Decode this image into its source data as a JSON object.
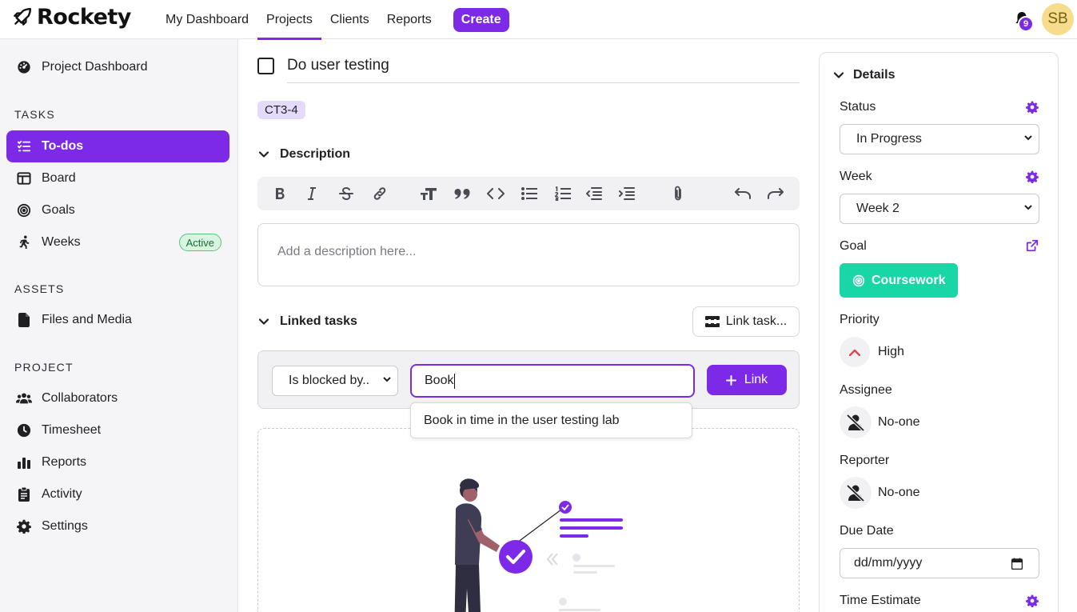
{
  "app": {
    "name": "Rockety"
  },
  "nav": {
    "items": [
      {
        "label": "My Dashboard"
      },
      {
        "label": "Projects"
      },
      {
        "label": "Clients"
      },
      {
        "label": "Reports"
      }
    ],
    "create_label": "Create",
    "notification_count": "9",
    "avatar_initials": "SB"
  },
  "sidebar": {
    "dashboard_label": "Project Dashboard",
    "tasks_heading": "TASKS",
    "tasks": [
      {
        "label": "To-dos"
      },
      {
        "label": "Board"
      },
      {
        "label": "Goals"
      },
      {
        "label": "Weeks",
        "badge": "Active"
      }
    ],
    "assets_heading": "ASSETS",
    "assets": [
      {
        "label": "Files and Media"
      }
    ],
    "project_heading": "PROJECT",
    "project": [
      {
        "label": "Collaborators"
      },
      {
        "label": "Timesheet"
      },
      {
        "label": "Reports"
      },
      {
        "label": "Activity"
      },
      {
        "label": "Settings"
      }
    ]
  },
  "task": {
    "title": "Do user testing",
    "code": "CT3-4",
    "description_heading": "Description",
    "description_placeholder": "Add a description here...",
    "linked_heading": "Linked tasks",
    "link_task_button": "Link task...",
    "relation_select": "Is blocked by..",
    "search_value": "Book",
    "link_button": "Link",
    "suggestion": "Book in time in the user testing lab"
  },
  "details": {
    "heading": "Details",
    "status_label": "Status",
    "status_value": "In Progress",
    "week_label": "Week",
    "week_value": "Week 2",
    "goal_label": "Goal",
    "goal_value": "Coursework",
    "priority_label": "Priority",
    "priority_value": "High",
    "assignee_label": "Assignee",
    "assignee_value": "No-one",
    "reporter_label": "Reporter",
    "reporter_value": "No-one",
    "due_label": "Due Date",
    "due_placeholder": "dd/mm/yyyy",
    "estimate_label": "Time Estimate"
  },
  "colors": {
    "accent": "#7c2ae8",
    "goal": "#19d6a7",
    "priority": "#e0464e"
  }
}
